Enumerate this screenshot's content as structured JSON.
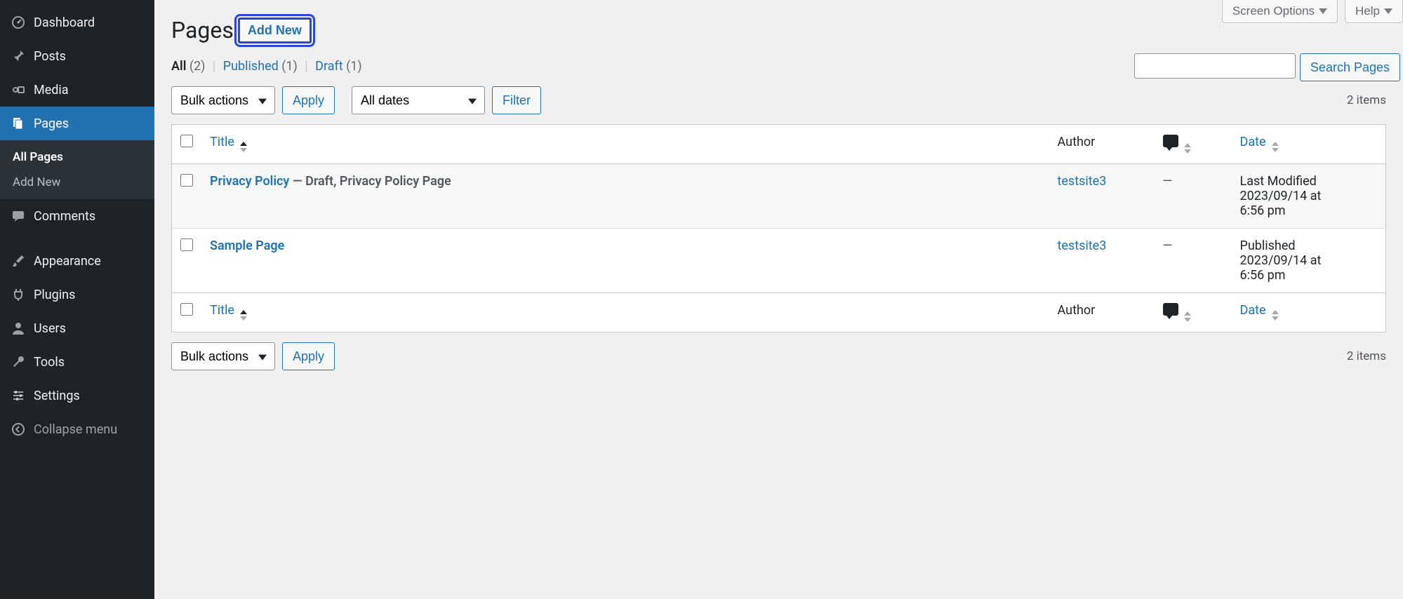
{
  "top": {
    "screen_options": "Screen Options",
    "help": "Help"
  },
  "sidebar": {
    "items": [
      {
        "label": "Dashboard",
        "icon": "dashboard"
      },
      {
        "label": "Posts",
        "icon": "pin"
      },
      {
        "label": "Media",
        "icon": "media"
      },
      {
        "label": "Pages",
        "icon": "pages",
        "current": true
      },
      {
        "label": "Comments",
        "icon": "comment"
      },
      {
        "label": "Appearance",
        "icon": "brush"
      },
      {
        "label": "Plugins",
        "icon": "plug"
      },
      {
        "label": "Users",
        "icon": "user"
      },
      {
        "label": "Tools",
        "icon": "wrench"
      },
      {
        "label": "Settings",
        "icon": "sliders"
      }
    ],
    "submenu": [
      {
        "label": "All Pages",
        "current": true
      },
      {
        "label": "Add New"
      }
    ],
    "collapse": "Collapse menu"
  },
  "header": {
    "title": "Pages",
    "add_new": "Add New"
  },
  "filters": {
    "all_label": "All",
    "all_count": "(2)",
    "published_label": "Published",
    "published_count": "(1)",
    "draft_label": "Draft",
    "draft_count": "(1)"
  },
  "search": {
    "button": "Search Pages"
  },
  "controls": {
    "bulk_actions": "Bulk actions",
    "apply": "Apply",
    "all_dates": "All dates",
    "filter": "Filter",
    "items_count": "2 items"
  },
  "columns": {
    "title": "Title",
    "author": "Author",
    "date": "Date"
  },
  "rows": [
    {
      "title": "Privacy Policy",
      "state": " — Draft, Privacy Policy Page",
      "author": "testsite3",
      "comments": "—",
      "date_line1": "Last Modified",
      "date_line2": "2023/09/14 at",
      "date_line3": "6:56 pm"
    },
    {
      "title": "Sample Page",
      "state": "",
      "author": "testsite3",
      "comments": "—",
      "date_line1": "Published",
      "date_line2": "2023/09/14 at",
      "date_line3": "6:56 pm"
    }
  ]
}
